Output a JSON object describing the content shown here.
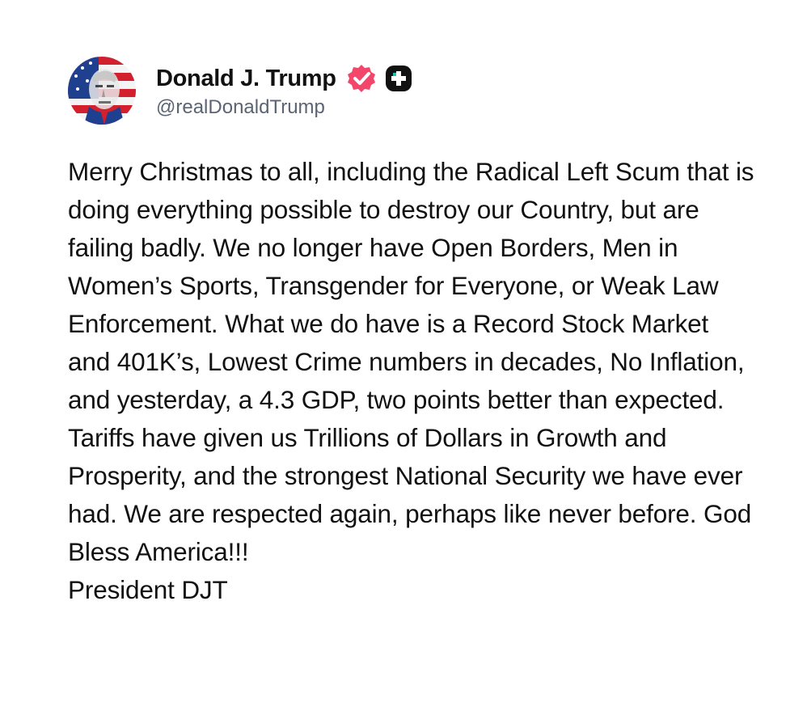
{
  "post": {
    "author": {
      "display_name": "Donald J. Trump",
      "handle": "@realDonaldTrump",
      "verified_icon": "verified-badge-icon",
      "plus_icon": "truth-plus-icon",
      "avatar_colors": {
        "red": "#d3202f",
        "blue": "#1f3f8f",
        "white": "#f4f4f4"
      }
    },
    "badge_color": "#f2476a",
    "plus_badge_color": "#111111",
    "text": "Merry Christmas to all, including the Radical Left Scum that is doing everything possible to destroy our Country, but are failing badly. We no longer have Open Borders, Men in Women’s Sports, Transgender for Everyone, or Weak Law Enforcement. What we do have is a Record Stock Market and 401K’s, Lowest Crime numbers in decades, No Inflation, and yesterday, a 4.3 GDP, two points better than expected. Tariffs have given us Trillions of Dollars in Growth and Prosperity, and the strongest National Security we have ever had. We are respected again, perhaps like never before. God Bless America!!!\nPresident DJT"
  }
}
